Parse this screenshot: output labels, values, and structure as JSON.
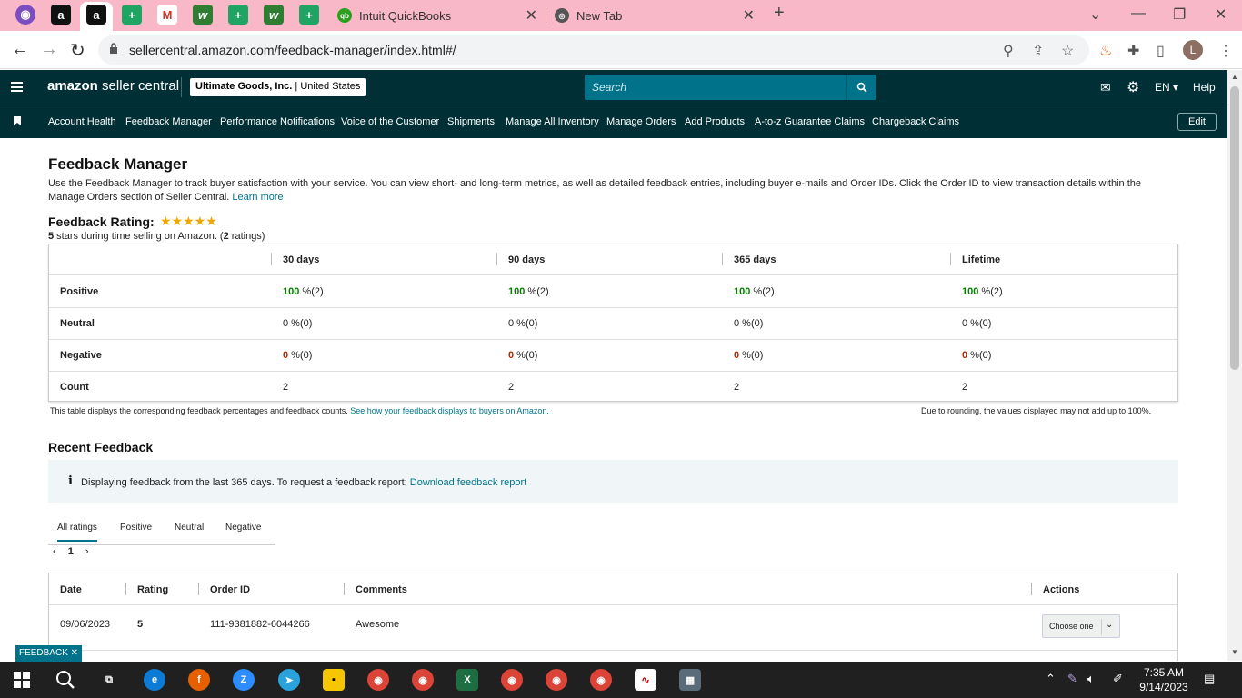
{
  "browser": {
    "tabs": [
      {
        "title": "Intuit QuickBooks"
      },
      {
        "title": "New Tab"
      }
    ],
    "url": "sellercentral.amazon.com/feedback-manager/index.html#/",
    "profile_initial": "L"
  },
  "header": {
    "logo_bold": "amazon",
    "logo_rest": " seller central",
    "account_name": "Ultimate Goods, Inc.",
    "account_region": "United States",
    "search_placeholder": "Search",
    "language": "EN",
    "help": "Help"
  },
  "nav": {
    "items": [
      "Account Health",
      "Feedback Manager",
      "Performance Notifications",
      "Voice of the Customer",
      "Shipments",
      "Manage All Inventory",
      "Manage Orders",
      "Add Products",
      "A-to-z Guarantee Claims",
      "Chargeback Claims"
    ],
    "edit": "Edit"
  },
  "page": {
    "title": "Feedback Manager",
    "description": "Use the Feedback Manager to track buyer satisfaction with your service. You can view short- and long-term metrics, as well as detailed feedback entries, including buyer e-mails and Order IDs. Click the Order ID to view transaction details within the Manage Orders section of Seller Central.",
    "learn_more": "Learn more",
    "rating_title": "Feedback Rating:",
    "stars": "★★★★★",
    "rating_value": "5",
    "rating_sub": " stars during time selling on Amazon. (",
    "rating_count": "2",
    "rating_sub_end": " ratings)"
  },
  "feedback_table": {
    "columns": [
      "30 days",
      "90 days",
      "365 days",
      "Lifetime"
    ],
    "rows": [
      {
        "label": "Positive",
        "cells": [
          {
            "v": "100",
            "r": " %(2)"
          },
          {
            "v": "100",
            "r": " %(2)"
          },
          {
            "v": "100",
            "r": " %(2)"
          },
          {
            "v": "100",
            "r": " %(2)"
          }
        ]
      },
      {
        "label": "Neutral",
        "cells": [
          {
            "v": "0",
            "r": " %(0)"
          },
          {
            "v": "0",
            "r": " %(0)"
          },
          {
            "v": "0",
            "r": " %(0)"
          },
          {
            "v": "0",
            "r": " %(0)"
          }
        ]
      },
      {
        "label": "Negative",
        "cells": [
          {
            "v": "0",
            "r": " %(0)"
          },
          {
            "v": "0",
            "r": " %(0)"
          },
          {
            "v": "0",
            "r": " %(0)"
          },
          {
            "v": "0",
            "r": " %(0)"
          }
        ]
      },
      {
        "label": "Count",
        "cells": [
          {
            "v": "",
            "r": "2"
          },
          {
            "v": "",
            "r": "2"
          },
          {
            "v": "",
            "r": "2"
          },
          {
            "v": "",
            "r": "2"
          }
        ]
      }
    ],
    "note_left": "This table displays the corresponding feedback percentages and feedback counts.",
    "note_link": "See how your feedback displays to buyers on Amazon.",
    "note_right": "Due to rounding, the values displayed may not add up to 100%."
  },
  "recent": {
    "title": "Recent Feedback",
    "info": "Displaying feedback from the last 365 days. To request a feedback report:",
    "info_link": "Download feedback report",
    "tabs": [
      "All ratings",
      "Positive",
      "Neutral",
      "Negative"
    ],
    "page": "1",
    "columns": [
      "Date",
      "Rating",
      "Order ID",
      "Comments",
      "Actions"
    ],
    "rows": [
      {
        "date": "09/06/2023",
        "rating": "5",
        "order_id": "111-9381882-6044266",
        "comment": "Awesome",
        "action": "Choose one"
      }
    ]
  },
  "feedback_tab": "FEEDBACK ✕",
  "taskbar": {
    "time": "7:35 AM",
    "date": "9/14/2023"
  },
  "colors": {
    "header_bg": "#002f36",
    "accent": "#00738a",
    "positive": "#067d00",
    "negative": "#b12704",
    "tabstrip": "#f8b8c8"
  }
}
